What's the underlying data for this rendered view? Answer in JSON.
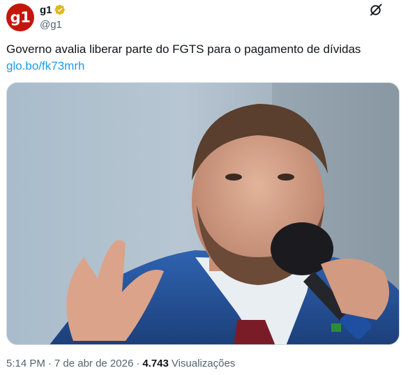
{
  "author": {
    "avatar_text": "g1",
    "display_name": "g1",
    "handle": "@g1",
    "verified_icon": "verified-gold-badge-icon"
  },
  "header": {
    "grok_icon": "grok-icon"
  },
  "tweet": {
    "text": "Governo avalia liberar parte do FGTS para o pagamento de dívidas",
    "link": "glo.bo/fk73mrh"
  },
  "media": {
    "alt": "Homem de terno azul e barba falando ao microfone"
  },
  "footer": {
    "time": "5:14 PM",
    "dot": "·",
    "date": "7 de abr de 2026",
    "dot2": "·",
    "views_count": "4.743",
    "views_label": "Visualizações"
  },
  "colors": {
    "brand": "#c4170c",
    "link": "#1d9bf0",
    "secondary_text": "#536471",
    "verified_gold": "#e2b719"
  }
}
